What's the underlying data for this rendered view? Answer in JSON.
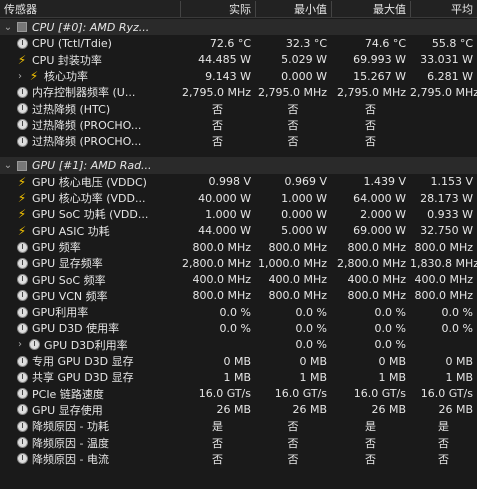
{
  "header": {
    "name": "传感器",
    "current": "实际",
    "min": "最小值",
    "max": "最大值",
    "avg": "平均"
  },
  "rows": [
    {
      "type": "section",
      "chev": "⌄",
      "icon": "chip",
      "label": "CPU [#0]: AMD Ryz..."
    },
    {
      "icon": "gauge",
      "label": "CPU (Tctl/Tdie)",
      "v": [
        "72.6 °C",
        "32.3 °C",
        "74.6 °C",
        "55.8 °C"
      ]
    },
    {
      "icon": "bolt",
      "label": "CPU 封装功率",
      "v": [
        "44.485 W",
        "5.029 W",
        "69.993 W",
        "33.031 W"
      ]
    },
    {
      "chev": "›",
      "icon": "bolt",
      "label": "核心功率",
      "indent": true,
      "v": [
        "9.143 W",
        "0.000 W",
        "15.267 W",
        "6.281 W"
      ]
    },
    {
      "icon": "gauge",
      "label": "内存控制器频率 (U...",
      "v": [
        "2,795.0 MHz",
        "2,795.0 MHz",
        "2,795.0 MHz",
        "2,795.0 MHz"
      ]
    },
    {
      "icon": "gauge",
      "label": "过热降频 (HTC)",
      "center": true,
      "v": [
        "否",
        "否",
        "否",
        ""
      ]
    },
    {
      "icon": "gauge",
      "label": "过热降频 (PROCHO...",
      "center": true,
      "v": [
        "否",
        "否",
        "否",
        ""
      ]
    },
    {
      "icon": "gauge",
      "label": "过热降频 (PROCHO...",
      "center": true,
      "v": [
        "否",
        "否",
        "否",
        ""
      ]
    },
    {
      "type": "gap"
    },
    {
      "type": "section",
      "chev": "⌄",
      "icon": "chip",
      "label": "GPU [#1]: AMD Rad..."
    },
    {
      "icon": "bolt",
      "label": "GPU 核心电压 (VDDC)",
      "v": [
        "0.998 V",
        "0.969 V",
        "1.439 V",
        "1.153 V"
      ]
    },
    {
      "icon": "bolt",
      "label": "GPU 核心功率 (VDD...",
      "v": [
        "40.000 W",
        "1.000 W",
        "64.000 W",
        "28.173 W"
      ]
    },
    {
      "icon": "bolt",
      "label": "GPU SoC 功耗 (VDD...",
      "v": [
        "1.000 W",
        "0.000 W",
        "2.000 W",
        "0.933 W"
      ]
    },
    {
      "icon": "bolt",
      "label": "GPU ASIC 功耗",
      "v": [
        "44.000 W",
        "5.000 W",
        "69.000 W",
        "32.750 W"
      ]
    },
    {
      "icon": "gauge",
      "label": "GPU 频率",
      "v": [
        "800.0 MHz",
        "800.0 MHz",
        "800.0 MHz",
        "800.0 MHz"
      ]
    },
    {
      "icon": "gauge",
      "label": "GPU 显存频率",
      "v": [
        "2,800.0 MHz",
        "1,000.0 MHz",
        "2,800.0 MHz",
        "1,830.8 MHz"
      ]
    },
    {
      "icon": "gauge",
      "label": "GPU SoC 频率",
      "v": [
        "400.0 MHz",
        "400.0 MHz",
        "400.0 MHz",
        "400.0 MHz"
      ]
    },
    {
      "icon": "gauge",
      "label": "GPU VCN 频率",
      "v": [
        "800.0 MHz",
        "800.0 MHz",
        "800.0 MHz",
        "800.0 MHz"
      ]
    },
    {
      "icon": "gauge",
      "label": "GPU利用率",
      "v": [
        "0.0 %",
        "0.0 %",
        "0.0 %",
        "0.0 %"
      ]
    },
    {
      "icon": "gauge",
      "label": "GPU D3D 使用率",
      "v": [
        "0.0 %",
        "0.0 %",
        "0.0 %",
        "0.0 %"
      ]
    },
    {
      "chev": "›",
      "icon": "gauge",
      "label": "GPU D3D利用率",
      "indent": true,
      "v": [
        "",
        "0.0 %",
        "0.0 %",
        ""
      ]
    },
    {
      "icon": "gauge",
      "label": "专用 GPU D3D 显存",
      "v": [
        "0 MB",
        "0 MB",
        "0 MB",
        "0 MB"
      ]
    },
    {
      "icon": "gauge",
      "label": "共享 GPU D3D 显存",
      "v": [
        "1 MB",
        "1 MB",
        "1 MB",
        "1 MB"
      ]
    },
    {
      "icon": "gauge",
      "label": "PCIe 链路速度",
      "v": [
        "16.0 GT/s",
        "16.0 GT/s",
        "16.0 GT/s",
        "16.0 GT/s"
      ]
    },
    {
      "icon": "gauge",
      "label": "GPU 显存使用",
      "v": [
        "26 MB",
        "26 MB",
        "26 MB",
        "26 MB"
      ]
    },
    {
      "icon": "gauge",
      "label": "降频原因 - 功耗",
      "center": true,
      "v": [
        "是",
        "否",
        "是",
        "是"
      ]
    },
    {
      "icon": "gauge",
      "label": "降频原因 - 温度",
      "center": true,
      "v": [
        "否",
        "否",
        "否",
        "否"
      ]
    },
    {
      "icon": "gauge",
      "label": "降频原因 - 电流",
      "center": true,
      "v": [
        "否",
        "否",
        "否",
        "否"
      ]
    }
  ]
}
